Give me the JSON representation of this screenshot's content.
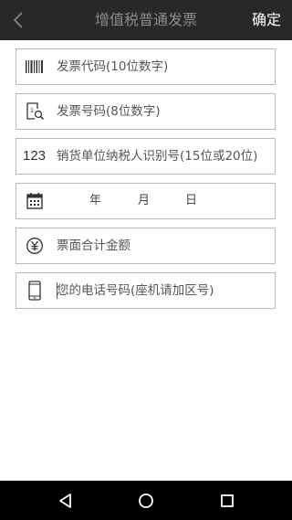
{
  "header": {
    "title": "增值税普通发票",
    "confirm_label": "确定"
  },
  "form": {
    "invoice_code": {
      "placeholder": "发票代码(10位数字)",
      "icon": "barcode-icon"
    },
    "invoice_number": {
      "placeholder": "发票号码(8位数字)",
      "icon": "document-search-icon"
    },
    "taxpayer_id": {
      "placeholder": "销货单位纳税人识别号(15位或20位)",
      "icon_text": "123"
    },
    "date": {
      "year_label": "年",
      "month_label": "月",
      "day_label": "日",
      "icon": "calendar-icon"
    },
    "amount": {
      "placeholder": "票面合计金额",
      "icon": "yuan-icon"
    },
    "phone": {
      "placeholder": "您的电话号码(座机请加区号)",
      "icon": "phone-icon"
    }
  },
  "navbar": {
    "icons": [
      "back-triangle-icon",
      "home-circle-icon",
      "recents-square-icon"
    ]
  },
  "colors": {
    "header_bg": "#282828",
    "title_text": "#8c8c8c",
    "field_border": "#b9b9b9"
  }
}
